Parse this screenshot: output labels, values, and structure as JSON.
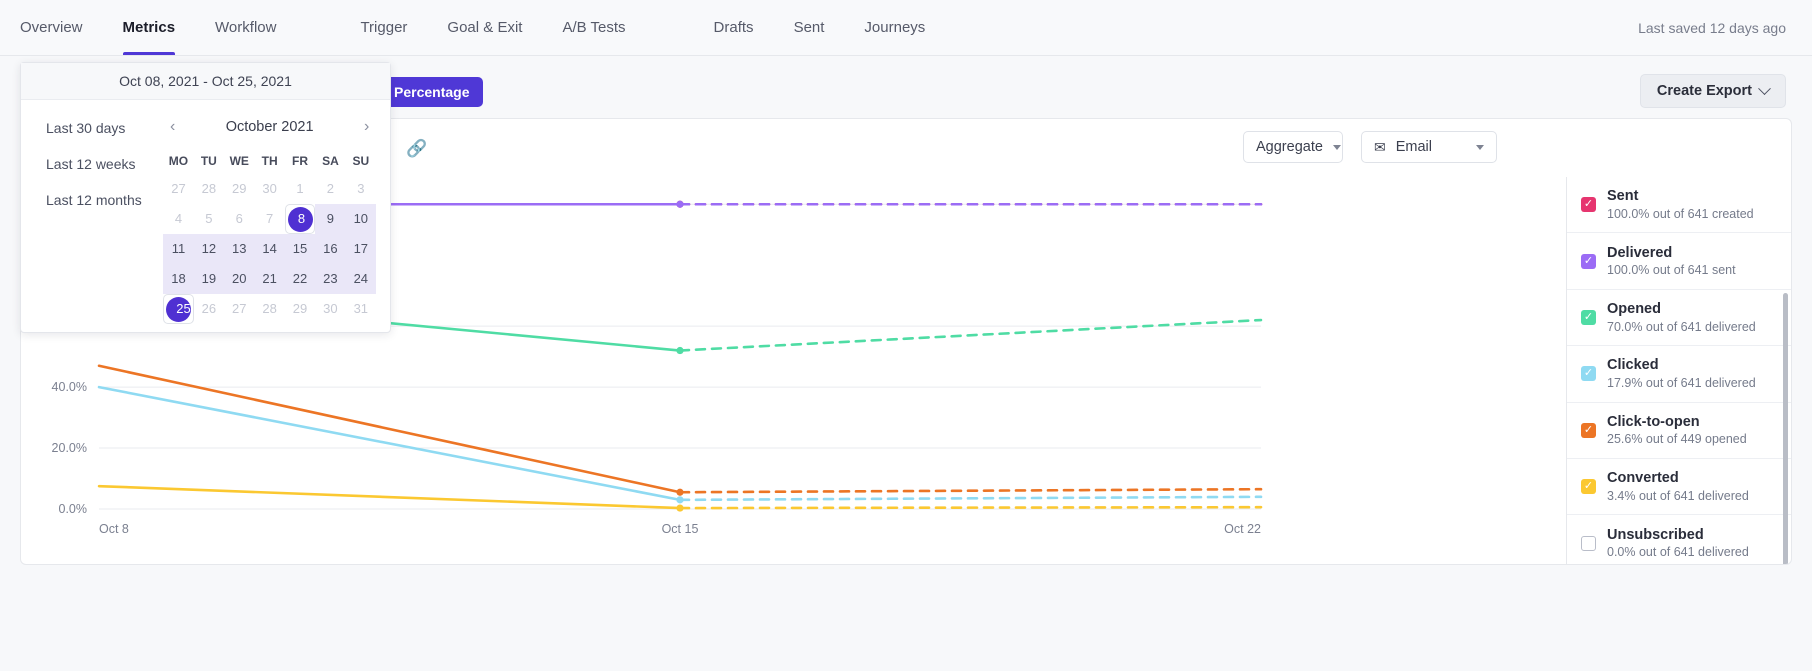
{
  "nav": {
    "primary": [
      {
        "label": "Overview",
        "active": false
      },
      {
        "label": "Metrics",
        "active": true
      },
      {
        "label": "Workflow",
        "active": false
      }
    ],
    "secondary": [
      {
        "label": "Trigger"
      },
      {
        "label": "Goal & Exit"
      },
      {
        "label": "A/B Tests"
      }
    ],
    "tertiary": [
      {
        "label": "Drafts"
      },
      {
        "label": "Sent"
      },
      {
        "label": "Journeys"
      }
    ],
    "saved_status": "Last saved 12 days ago"
  },
  "toolbar": {
    "percentage_label": "Percentage",
    "create_export_label": "Create Export",
    "link_icon": "link-icon",
    "aggregate_label": "Aggregate",
    "email_label": "Email",
    "email_icon": "envelope-icon"
  },
  "datepicker": {
    "range_label": "Oct 08, 2021 - Oct 25, 2021",
    "presets": [
      "Last 30 days",
      "Last 12 weeks",
      "Last 12 months"
    ],
    "prev_icon": "chevron-left-icon",
    "next_icon": "chevron-right-icon",
    "month_label": "October 2021",
    "dow": [
      "MO",
      "TU",
      "WE",
      "TH",
      "FR",
      "SA",
      "SU"
    ],
    "weeks": [
      [
        {
          "d": "27",
          "state": "mute"
        },
        {
          "d": "28",
          "state": "mute"
        },
        {
          "d": "29",
          "state": "mute"
        },
        {
          "d": "30",
          "state": "mute"
        },
        {
          "d": "1",
          "state": "mute"
        },
        {
          "d": "2",
          "state": "mute"
        },
        {
          "d": "3",
          "state": "mute"
        }
      ],
      [
        {
          "d": "4",
          "state": "mute"
        },
        {
          "d": "5",
          "state": "mute"
        },
        {
          "d": "6",
          "state": "mute"
        },
        {
          "d": "7",
          "state": "mute"
        },
        {
          "d": "8",
          "state": "sel"
        },
        {
          "d": "9",
          "state": "normal"
        },
        {
          "d": "10",
          "state": "normal"
        }
      ],
      [
        {
          "d": "11",
          "state": "inrange"
        },
        {
          "d": "12",
          "state": "inrange"
        },
        {
          "d": "13",
          "state": "inrange"
        },
        {
          "d": "14",
          "state": "inrange"
        },
        {
          "d": "15",
          "state": "inrange"
        },
        {
          "d": "16",
          "state": "inrange"
        },
        {
          "d": "17",
          "state": "inrange"
        }
      ],
      [
        {
          "d": "18",
          "state": "inrange"
        },
        {
          "d": "19",
          "state": "inrange"
        },
        {
          "d": "20",
          "state": "inrange"
        },
        {
          "d": "21",
          "state": "inrange"
        },
        {
          "d": "22",
          "state": "inrange"
        },
        {
          "d": "23",
          "state": "inrange"
        },
        {
          "d": "24",
          "state": "inrange"
        }
      ],
      [
        {
          "d": "25",
          "state": "sel"
        },
        {
          "d": "26",
          "state": "mute"
        },
        {
          "d": "27",
          "state": "mute"
        },
        {
          "d": "28",
          "state": "mute"
        },
        {
          "d": "29",
          "state": "mute"
        },
        {
          "d": "30",
          "state": "mute"
        },
        {
          "d": "31",
          "state": "mute"
        }
      ]
    ]
  },
  "legend": {
    "items": [
      {
        "name": "Sent",
        "sub": "100.0% out of 641 created",
        "color": "#e6356f",
        "checked": true
      },
      {
        "name": "Delivered",
        "sub": "100.0% out of 641 sent",
        "color": "#9b6cf5",
        "checked": true
      },
      {
        "name": "Opened",
        "sub": "70.0% out of 641 delivered",
        "color": "#4fdca4",
        "checked": true
      },
      {
        "name": "Clicked",
        "sub": "17.9% out of 641 delivered",
        "color": "#8fdaf2",
        "checked": true
      },
      {
        "name": "Click-to-open",
        "sub": "25.6% out of 449 opened",
        "color": "#ec7525",
        "checked": true
      },
      {
        "name": "Converted",
        "sub": "3.4% out of 641 delivered",
        "color": "#fbc831",
        "checked": true
      },
      {
        "name": "Unsubscribed",
        "sub": "0.0% out of 641 delivered",
        "color": "#ffffff",
        "checked": false
      }
    ]
  },
  "chart_data": {
    "type": "line",
    "title": "",
    "xlabel": "",
    "ylabel": "",
    "ylim": [
      0,
      100
    ],
    "yticks": [
      "0.0%",
      "20.0%",
      "40.0%"
    ],
    "ytick_values": [
      0,
      20,
      40
    ],
    "grid": true,
    "xticks": [
      "Oct 8",
      "Oct 15",
      "Oct 22"
    ],
    "x": [
      "Oct 8",
      "Oct 15",
      "Oct 22"
    ],
    "solid_until": "Oct 15",
    "note": "segments after Oct 15 are rendered dashed (projected)",
    "series": [
      {
        "name": "Sent",
        "color": "#e6356f",
        "values": [
          100.0,
          100.0,
          100.0
        ]
      },
      {
        "name": "Delivered",
        "color": "#9b6cf5",
        "values": [
          100.0,
          100.0,
          100.0
        ]
      },
      {
        "name": "Opened",
        "color": "#4fdca4",
        "values": [
          70.0,
          52.0,
          62.0
        ]
      },
      {
        "name": "Click-to-open",
        "color": "#ec7525",
        "values": [
          47.0,
          5.5,
          6.5
        ]
      },
      {
        "name": "Clicked",
        "color": "#8fdaf2",
        "values": [
          40.0,
          3.0,
          4.0
        ]
      },
      {
        "name": "Converted",
        "color": "#fbc831",
        "values": [
          7.5,
          0.3,
          0.6
        ]
      },
      {
        "name": "Unsubscribed",
        "color": "#ffffff",
        "values": [
          0.0,
          0.0,
          0.0
        ]
      }
    ]
  }
}
